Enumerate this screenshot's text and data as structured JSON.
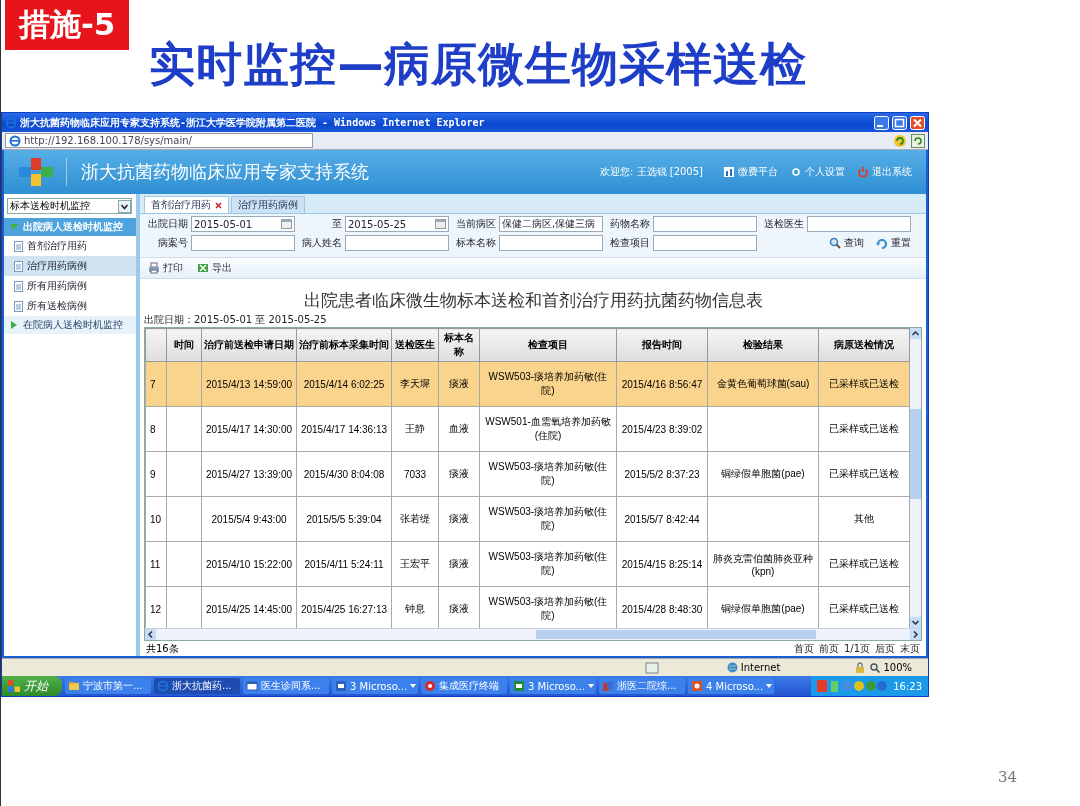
{
  "slide": {
    "badge": "措施-5",
    "title": "实时监控—病原微生物采样送检",
    "page_number": "34"
  },
  "browser": {
    "title": "浙大抗菌药物临床应用专家支持系统-浙江大学医学院附属第二医院 - Windows Internet Explorer",
    "address": "http://192.168.100.178/sys/main/",
    "status_zone": "Internet",
    "zoom": "100%"
  },
  "app": {
    "title": "浙大抗菌药物临床应用专家支持系统",
    "welcome": "欢迎您: 王选锐 [2005]",
    "links": [
      {
        "label": "缴费平台",
        "kind": "chart"
      },
      {
        "label": "个人设置",
        "kind": "dot"
      },
      {
        "label": "退出系统",
        "kind": "power"
      }
    ]
  },
  "sidebar": {
    "dropdown": "标本送检时机监控",
    "groups": [
      {
        "label": "出院病人送检时机监控",
        "expanded": true,
        "children": [
          {
            "label": "首剂治疗用药",
            "selected": false
          },
          {
            "label": "治疗用药病例",
            "selected": true
          },
          {
            "label": "所有用药病例",
            "selected": false
          },
          {
            "label": "所有送检病例",
            "selected": false
          }
        ]
      },
      {
        "label": "在院病人送检时机监控",
        "expanded": false
      }
    ]
  },
  "tabs": [
    {
      "label": "首剂治疗用药",
      "selected": true,
      "closable": true
    },
    {
      "label": "治疗用药病例",
      "selected": false,
      "closable": false
    }
  ],
  "filters": [
    [
      {
        "label": "出院日期",
        "value": "2015-05-01",
        "kind": "date"
      },
      {
        "label": "至",
        "value": "2015-05-25",
        "kind": "date"
      },
      {
        "label": "当前病区",
        "value": "保健二病区,保健三病",
        "kind": "text"
      },
      {
        "label": "药物名称",
        "kind": "text"
      },
      {
        "label": "送检医生",
        "kind": "text"
      }
    ],
    [
      {
        "label": "病案号",
        "kind": "text"
      },
      {
        "label": "病人姓名",
        "kind": "text"
      },
      {
        "label": "标本名称",
        "kind": "text"
      },
      {
        "label": "检查项目",
        "kind": "text"
      }
    ]
  ],
  "actions": [
    {
      "label": "查询",
      "kind": "search"
    },
    {
      "label": "重置",
      "kind": "reset"
    }
  ],
  "toolbar": [
    {
      "label": "打印",
      "kind": "print"
    },
    {
      "label": "导出",
      "kind": "export"
    }
  ],
  "report": {
    "title": "出院患者临床微生物标本送检和首剂治疗用药抗菌药物信息表",
    "date_range": "出院日期：2015-05-01 至 2015-05-25",
    "columns": [
      "时间",
      "治疗前送检申请日期",
      "治疗前标本采集时间",
      "送检医生",
      "标本名称",
      "检查项目",
      "报告时间",
      "检验结果",
      "病原送检情况"
    ],
    "rows": [
      {
        "no": "7",
        "highlighted": true,
        "cells": [
          null,
          "2015/4/13 14:59:00",
          "2015/4/14 6:02:25",
          "李天墀",
          "痰液",
          "WSW503-痰培养加药敏(住院)",
          "2015/4/16 8:56:47",
          "金黄色葡萄球菌(sau)",
          "已采样或已送检"
        ]
      },
      {
        "no": "8",
        "highlighted": false,
        "cells": [
          null,
          "2015/4/17 14:30:00",
          "2015/4/17 14:36:13",
          "王静",
          "血液",
          "WSW501-血需氧培养加药敏(住院)",
          "2015/4/23 8:39:02",
          null,
          "已采样或已送检"
        ]
      },
      {
        "no": "9",
        "highlighted": false,
        "cells": [
          null,
          "2015/4/27 13:39:00",
          "2015/4/30 8:04:08",
          "7033",
          "痰液",
          "WSW503-痰培养加药敏(住院)",
          "2015/5/2 8:37:23",
          "铜绿假单胞菌(pae)",
          "已采样或已送检"
        ]
      },
      {
        "no": "10",
        "highlighted": false,
        "cells": [
          null,
          "2015/5/4 9:43:00",
          "2015/5/5 5:39:04",
          "张若缇",
          "痰液",
          "WSW503-痰培养加药敏(住院)",
          "2015/5/7 8:42:44",
          null,
          "其他"
        ]
      },
      {
        "no": "11",
        "highlighted": false,
        "cells": [
          null,
          "2015/4/10 15:22:00",
          "2015/4/11 5:24:11",
          "王宏平",
          "痰液",
          "WSW503-痰培养加药敏(住院)",
          "2015/4/15 8:25:14",
          "肺炎克雷伯菌肺炎亚种(kpn)",
          "已采样或已送检"
        ]
      },
      {
        "no": "12",
        "highlighted": false,
        "cells": [
          null,
          "2015/4/25 14:45:00",
          "2015/4/25 16:27:13",
          "钟息",
          "痰液",
          "WSW503-痰培养加药敏(住院)",
          "2015/4/28 8:48:30",
          "铜绿假单胞菌(pae)",
          "已采样或已送检"
        ]
      }
    ],
    "total": "共16条",
    "pager": [
      "首页",
      "前页",
      "1/1页",
      "后页",
      "末页"
    ]
  },
  "taskbar": {
    "start": "开始",
    "items": [
      {
        "label": "宁波市第一...",
        "selected": false,
        "kind": "folder"
      },
      {
        "label": "浙大抗菌药...",
        "selected": true,
        "kind": "browser"
      },
      {
        "label": "医生诊间系...",
        "selected": false,
        "kind": "window"
      },
      {
        "label": "3 Microso...",
        "selected": false,
        "kind": "word",
        "menu": true
      },
      {
        "label": "集成医疗终端",
        "selected": false,
        "kind": "record"
      },
      {
        "label": "3 Microso...",
        "selected": false,
        "kind": "excel",
        "menu": true
      },
      {
        "label": "浙医二院综...",
        "selected": false,
        "kind": "app"
      },
      {
        "label": "4 Microso...",
        "selected": false,
        "kind": "ppt",
        "menu": true
      }
    ],
    "clock": "16:23"
  }
}
